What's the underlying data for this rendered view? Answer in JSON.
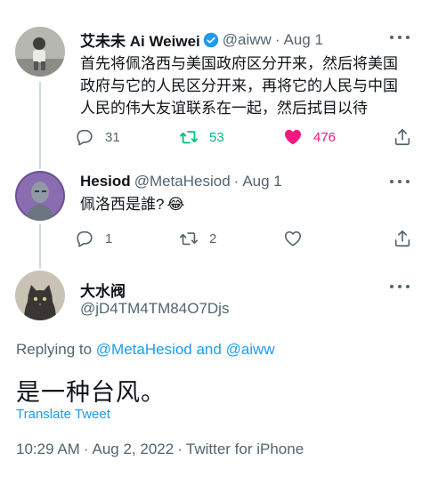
{
  "colors": {
    "accent": "#1d9bf0",
    "retweet": "#00ba7c",
    "like": "#f91880",
    "secondary_text": "#536471",
    "divider": "#cfd9de"
  },
  "tweet1": {
    "name": "艾未未 Ai Weiwei",
    "verified": true,
    "handle": "@aiww",
    "dot": "·",
    "date": "Aug 1",
    "text_lines": [
      "首先将佩洛西与美国政府区分开来，然后将美国",
      "政府与它的人民区分开来，再将它的人民与中国",
      "人民的伟大友谊联系在一起，然后拭目以待"
    ],
    "replies": "31",
    "retweets": "53",
    "likes": "476",
    "liked": true
  },
  "tweet2": {
    "name": "Hesiod",
    "handle": "@MetaHesiod",
    "dot": "·",
    "date": "Aug 1",
    "text": "佩洛西是誰?",
    "emoji": "😂",
    "replies": "1",
    "retweets": "2",
    "likes": ""
  },
  "main_tweet": {
    "name": "大水阀",
    "handle": "@jD4TM4TM84O7Djs",
    "replying_prefix": "Replying to ",
    "replying_user1": "@MetaHesiod",
    "replying_and": " and ",
    "replying_user2": "@aiww",
    "text": "是一种台风。",
    "translate": "Translate Tweet",
    "time": "10:29 AM",
    "sep": "·",
    "date": "Aug 2, 2022",
    "source": "Twitter for iPhone"
  },
  "icons": [
    "verified-badge-icon",
    "more-icon",
    "reply-icon",
    "retweet-icon",
    "like-icon",
    "share-icon"
  ]
}
